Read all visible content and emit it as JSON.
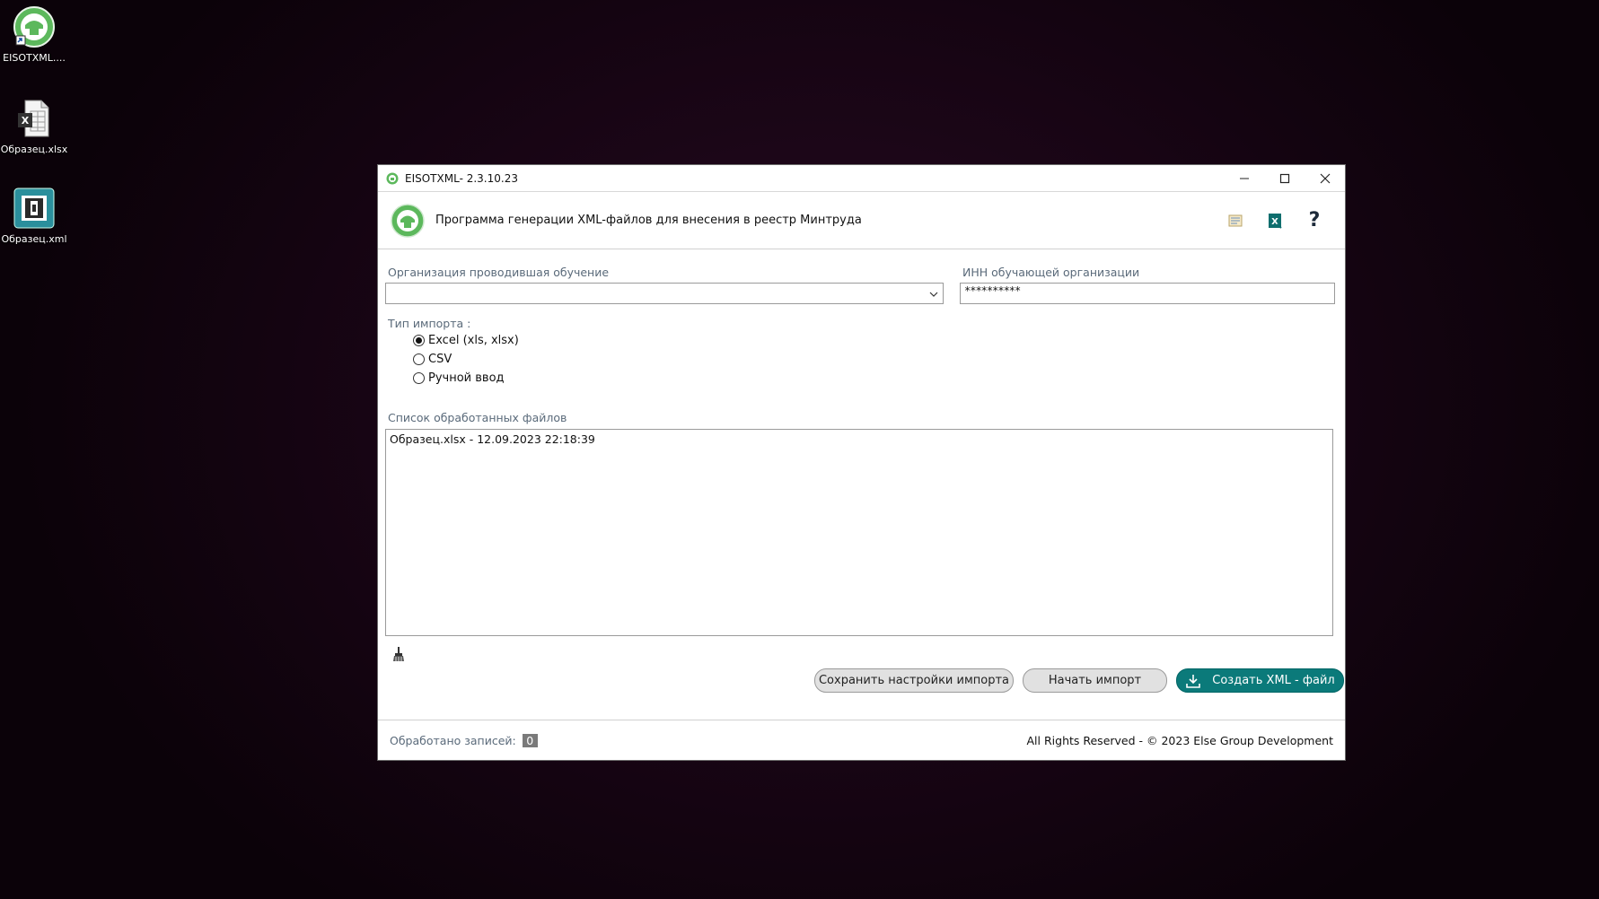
{
  "desktop": {
    "icons": [
      {
        "label": "EISOTXML...."
      },
      {
        "label": "Образец.xlsx"
      },
      {
        "label": "Образец.xml"
      }
    ]
  },
  "window": {
    "title": "EISOTXML- 2.3.10.23",
    "controls": {
      "minimize": "—",
      "maximize": "☐",
      "close": "✕"
    }
  },
  "header": {
    "app_title": "Программа генерации XML-файлов для внесения в реестр Минтруда",
    "help": "?"
  },
  "form": {
    "org_label": "Организация проводившая обучение",
    "org_value": "",
    "inn_label": "ИНН обучающей организации",
    "inn_value": "**********",
    "import_type_label": "Тип импорта :",
    "import_options": [
      {
        "label": "Excel (xls, xlsx)",
        "checked": true
      },
      {
        "label": "CSV",
        "checked": false
      },
      {
        "label": "Ручной ввод",
        "checked": false
      }
    ],
    "files_label": "Список обработанных файлов",
    "files": [
      "Образец.xlsx - 12.09.2023 22:18:39"
    ]
  },
  "buttons": {
    "save_settings": "Сохранить настройки импорта",
    "start_import": "Начать импорт",
    "create_xml": "Создать XML - файл"
  },
  "footer": {
    "processed_label": "Обработано записей:",
    "processed_value": "0",
    "copyright": "All Rights Reserved - © 2023 Else Group Development"
  },
  "colors": {
    "accent": "#0b7a7a",
    "logo_green": "#4caf50"
  }
}
